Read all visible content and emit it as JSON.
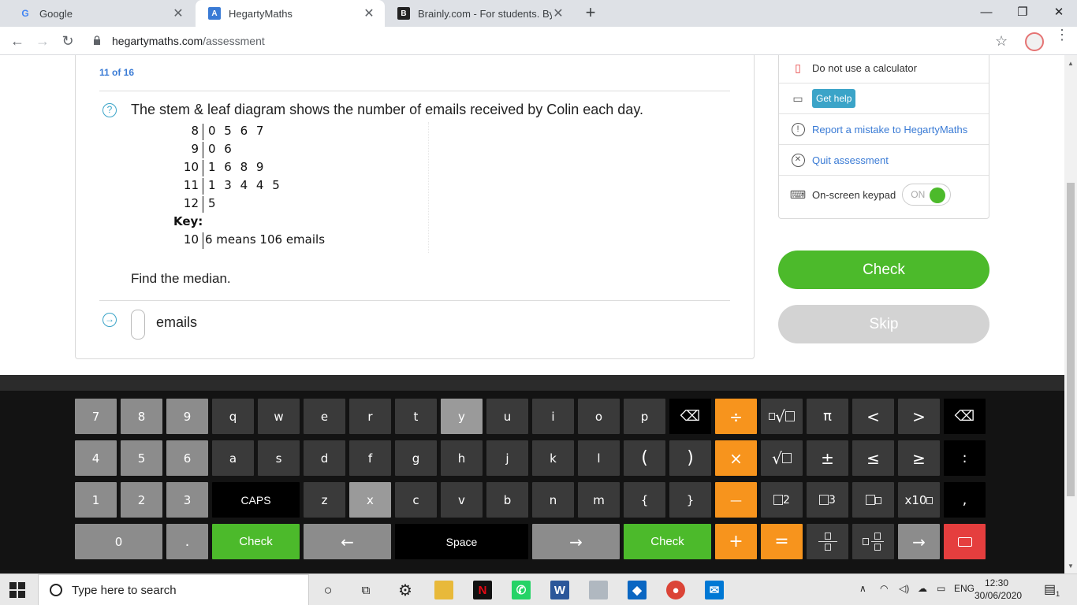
{
  "browser": {
    "tabs": [
      {
        "title": "Google",
        "active": false
      },
      {
        "title": "HegartyMaths",
        "active": true
      },
      {
        "title": "Brainly.com - For students. By stu",
        "active": false
      }
    ],
    "url_host": "hegartymaths.com",
    "url_path": "/assessment"
  },
  "question": {
    "counter": "11 of 16",
    "text": "The stem & leaf diagram shows the number of emails received by Colin each day.",
    "stem_leaf": [
      {
        "stem": "8",
        "leaves": "0 5 6 7"
      },
      {
        "stem": "9",
        "leaves": "0 6"
      },
      {
        "stem": "10",
        "leaves": "1 6 8 9"
      },
      {
        "stem": "11",
        "leaves": "1 3 4 4 5"
      },
      {
        "stem": "12",
        "leaves": "5"
      }
    ],
    "key_label": "Key:",
    "key_stem": "10",
    "key_text": "6 means 106 emails",
    "prompt": "Find the median.",
    "answer_value": "",
    "answer_unit": "emails"
  },
  "sidebar": {
    "calculator": "Do not use a calculator",
    "get_help": "Get help",
    "report": "Report a mistake to HegartyMaths",
    "quit": "Quit assessment",
    "keypad_label": "On-screen keypad",
    "keypad_toggle": "ON"
  },
  "actions": {
    "check": "Check",
    "skip": "Skip"
  },
  "keypad": {
    "row1": [
      "7",
      "8",
      "9",
      "q",
      "w",
      "e",
      "r",
      "t",
      "y",
      "u",
      "i",
      "o",
      "p",
      "⌫",
      "÷",
      "√",
      "π",
      "<",
      ">",
      "⌫"
    ],
    "row2": [
      "4",
      "5",
      "6",
      "a",
      "s",
      "d",
      "f",
      "g",
      "h",
      "j",
      "k",
      "l",
      "(",
      ")",
      "×",
      "√",
      "±",
      "≤",
      "≥",
      ":"
    ],
    "row3": [
      "1",
      "2",
      "3",
      "CAPS",
      "z",
      "x",
      "c",
      "v",
      "b",
      "n",
      "m",
      "{",
      "}",
      "—",
      "2",
      "3",
      "",
      "x10",
      ","
    ],
    "row4": [
      "0",
      ".",
      "Check",
      "←",
      "Space",
      "→",
      "Check",
      "+",
      "=",
      "",
      "",
      "→",
      ""
    ]
  },
  "taskbar": {
    "search_placeholder": "Type here to search",
    "lang": "ENG",
    "time": "12:30",
    "date": "30/06/2020",
    "notifications": "1"
  },
  "colors": {
    "accent_blue": "#3a7bd5",
    "help_teal": "#3ba4c8",
    "green": "#4cba2b",
    "orange": "#f7941d",
    "red": "#e53e3e"
  }
}
